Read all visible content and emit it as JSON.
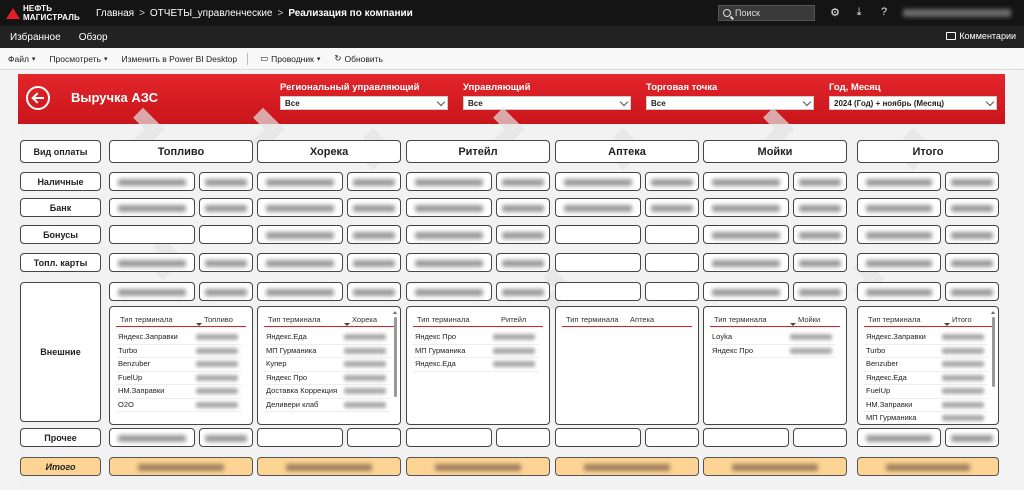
{
  "header": {
    "logo_line1": "НЕФТЬ",
    "logo_line2": "МАГИСТРАЛЬ",
    "breadcrumb": [
      "Главная",
      "ОТЧЕТЫ_управленческие",
      "Реализация по компании"
    ],
    "search_placeholder": "Поиск",
    "icons": [
      "gear-icon",
      "download-icon",
      "help-icon"
    ]
  },
  "nav": {
    "favorites": "Избранное",
    "overview": "Обзор",
    "comments": "Комментарии"
  },
  "toolbar": {
    "file": "Файл",
    "view": "Просмотреть",
    "edit_pbi": "Изменить в Power BI Desktop",
    "explorer": "Проводник",
    "refresh": "Обновить"
  },
  "report": {
    "title": "Выручка АЗС",
    "accent_color": "#e31e24",
    "total_color": "#fdd493",
    "slicers": [
      {
        "label": "Региональный управляющий",
        "value": "Все"
      },
      {
        "label": "Управляющий",
        "value": "Все"
      },
      {
        "label": "Торговая точка",
        "value": "Все"
      },
      {
        "label": "Год, Месяц",
        "value": "2024 (Год) + ноябрь (Месяц)"
      }
    ],
    "pay_type_header": "Вид оплаты",
    "columns": [
      "Топливо",
      "Хорека",
      "Ритейл",
      "Аптека",
      "Мойки",
      "Итого"
    ],
    "rows": [
      "Наличные",
      "Банк",
      "Бонусы",
      "Топл. карты",
      "Внешние",
      "Прочее"
    ],
    "total_label": "Итого",
    "terminal_tables": [
      {
        "col_header": "Тип терминала",
        "val_header": "Топливо",
        "items": [
          "Яндекс.Заправки",
          "Turbo",
          "Benzuber",
          "FuelUp",
          "НМ.Заправки",
          "O2O"
        ]
      },
      {
        "col_header": "Тип терминала",
        "val_header": "Хорека",
        "items": [
          "Яндекс.Еда",
          "МП Гурманика",
          "Купер",
          "Яндекс Про",
          "Доставка Коррекция",
          "Деливери клаб"
        ]
      },
      {
        "col_header": "Тип терминала",
        "val_header": "Ритейл",
        "items": [
          "Яндекс Про",
          "МП Гурманика",
          "Яндекс.Еда"
        ]
      },
      {
        "col_header": "Тип терминала",
        "val_header": "Аптека",
        "items": []
      },
      {
        "col_header": "Тип терминала",
        "val_header": "Мойки",
        "items": [
          "Loyka",
          "Яндекс Про"
        ]
      },
      {
        "col_header": "Тип терминала",
        "val_header": "Итого",
        "items": [
          "Яндекс.Заправки",
          "Turbo",
          "Benzuber",
          "Яндекс.Еда",
          "FuelUp",
          "НМ.Заправки",
          "МП Гурманика"
        ]
      }
    ]
  }
}
